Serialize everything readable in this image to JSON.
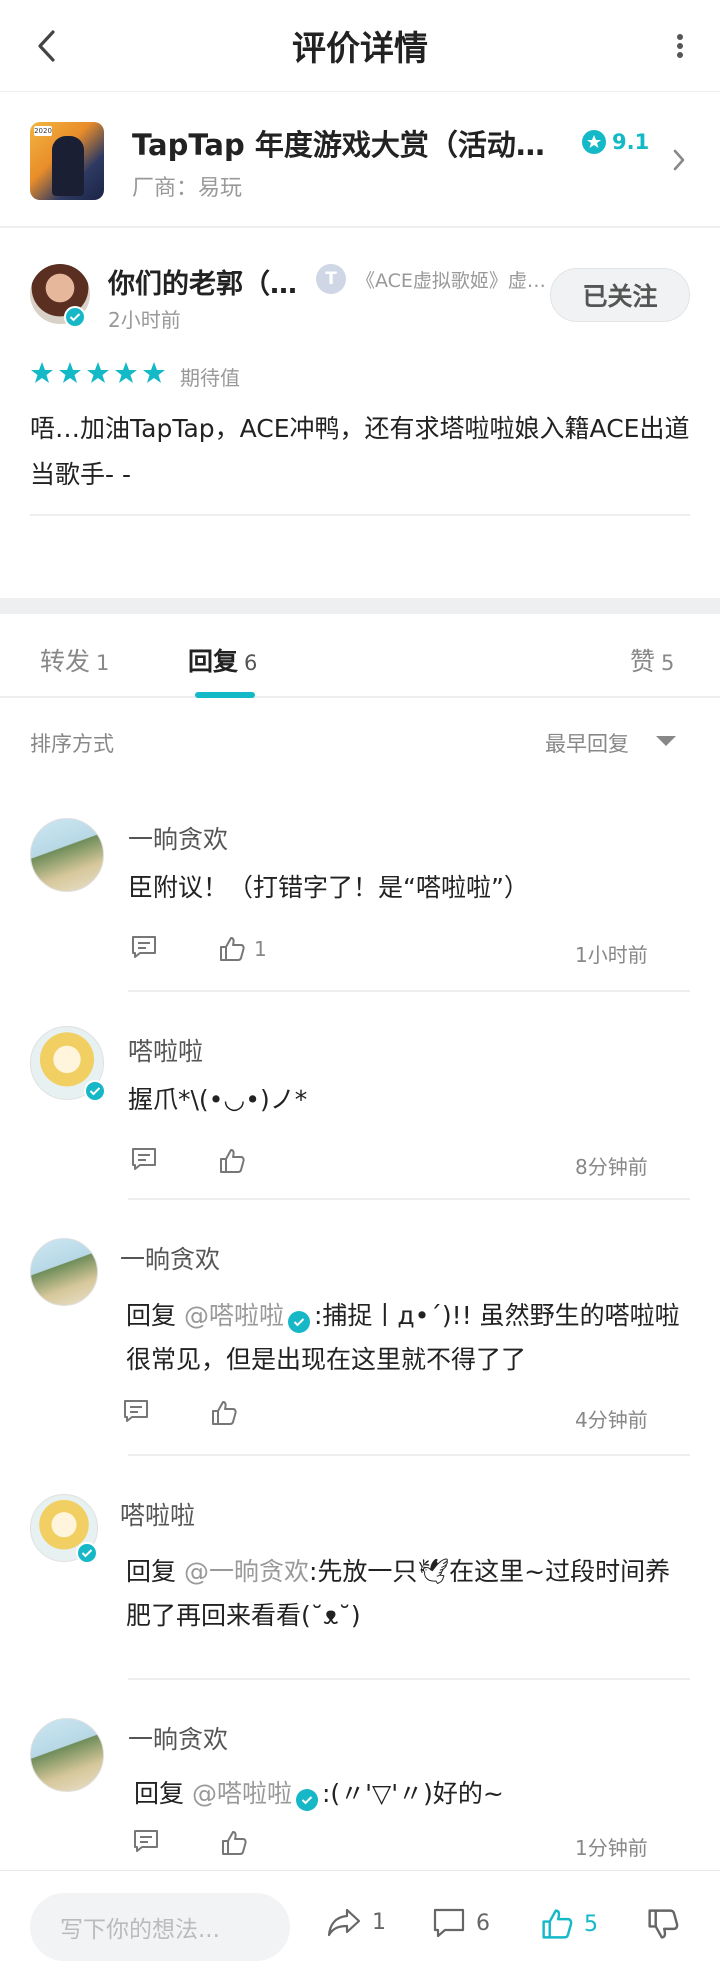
{
  "topbar": {
    "title": "评价详情"
  },
  "game": {
    "title": "TapTap 年度游戏大赏（活动…",
    "vendor": "厂商：易玩",
    "rating": "9.1",
    "icon_badge": "2020"
  },
  "review": {
    "author": "你们的老郭（…",
    "tag_icon": "T",
    "tag_text": "《ACE虚拟歌姬》虚…",
    "time": "2小时前",
    "follow_label": "已关注",
    "stars": 5,
    "rating_label": "期待值",
    "body": "唔…加油TapTap，ACE冲鸭，还有求塔啦啦娘入籍ACE出道当歌手- -"
  },
  "tabs": [
    {
      "label": "转发",
      "count": "1"
    },
    {
      "label": "回复",
      "count": "6"
    },
    {
      "label": "赞",
      "count": "5"
    }
  ],
  "sort": {
    "label": "排序方式",
    "value": "最早回复"
  },
  "comments": [
    {
      "name": "一晌贪欢",
      "text": "臣附议！（打错字了！是“嗒啦啦”）",
      "likes": "1",
      "time": "1小时前"
    },
    {
      "name": "嗒啦啦",
      "text": "握爪*\\(•◡•)ノ*",
      "likes": "",
      "time": "8分钟前"
    },
    {
      "name": "一晌贪欢",
      "reply_prefix": "回复 ",
      "mention": "@嗒啦啦",
      "text": ":捕捉丨д•´)!! 虽然野生的嗒啦啦很常见，但是出现在这里就不得了了",
      "likes": "",
      "time": "4分钟前"
    },
    {
      "name": "嗒啦啦",
      "reply_prefix": "回复 ",
      "mention": "@一晌贪欢",
      "text": ":先放一只🕊在这里~过段时间养肥了再回来看看(˘ᴥ˘)",
      "likes": "",
      "time": ""
    },
    {
      "name": "一晌贪欢",
      "reply_prefix": "回复 ",
      "mention": "@嗒啦啦",
      "text": ":(〃'▽'〃)好的~",
      "likes": "",
      "time": "1分钟前"
    }
  ],
  "bottombar": {
    "input_placeholder": "写下你的想法...",
    "share_count": "1",
    "comment_count": "6",
    "like_count": "5"
  },
  "colors": {
    "accent": "#14b9c8",
    "text": "#222222",
    "muted": "#888888"
  }
}
